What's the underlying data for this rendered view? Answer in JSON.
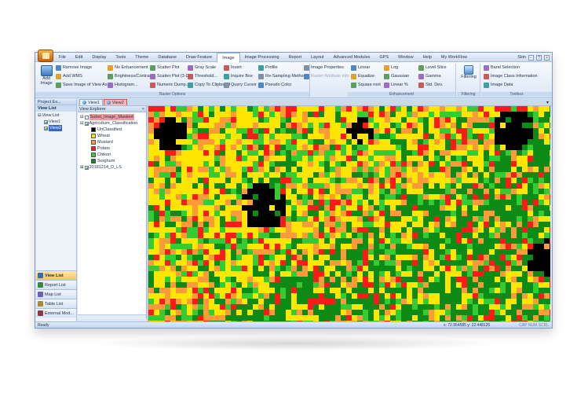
{
  "menu": {
    "items": [
      "File",
      "Edit",
      "Display",
      "Tools",
      "Theme",
      "Database",
      "Draw Feature",
      "Image",
      "Image Processing",
      "Report",
      "Layout",
      "Advanced Modules",
      "GPS",
      "Window",
      "Help",
      "My WorkFlow"
    ],
    "active": "Image",
    "skin_label": "Skin",
    "help_glyph": "?"
  },
  "ribbon": {
    "add_image": {
      "line1": "Add",
      "line2": "Image"
    },
    "col1": [
      "Remove Image",
      "Add WMS",
      "Save Image of View As..."
    ],
    "col2": [
      "No Enhancement",
      "Brightness/Contrast...",
      "Histogram..."
    ],
    "col3": [
      "Scatter Plot",
      "Scatter Plot (3-D)",
      "Numeric Dump..."
    ],
    "col4": [
      "Gray Scale",
      "Threshold...",
      "Copy To Clipboard"
    ],
    "col5": [
      "Invert",
      "Inquire Box",
      "Query Cursor"
    ],
    "col6": [
      "Profile",
      "Re-Sampling Method",
      "Pseudo Color"
    ],
    "col7": [
      "Image Properties",
      "Raster Attribute Info",
      ""
    ],
    "group_raster_options": "Raster Options",
    "enh_col1": [
      "Linear",
      "Equalize",
      "Square root"
    ],
    "enh_col2": [
      "Log",
      "Gaussian",
      "Linear %"
    ],
    "enh_col3": [
      "Level Slice",
      "Gamma",
      "Std. Dev."
    ],
    "group_enhancement": "Enhancement",
    "filtering_label": "Filtering",
    "group_filtering": "Filtering",
    "toolbox_items": [
      "Band Selection",
      "Image Class Information",
      "Image Data"
    ],
    "group_toolbox": "Toolbox"
  },
  "project_explorer": {
    "title": "Project Ex...",
    "view_list_header": "View List",
    "tree_root": "View List",
    "views": [
      "View1",
      "View2"
    ],
    "selected_view": "View2",
    "nav_buttons": [
      "View List",
      "Report List",
      "Map List",
      "Table List",
      "External Mod..."
    ]
  },
  "doc_tabs": [
    "View1",
    "View2"
  ],
  "active_doc_tab": "View2",
  "view_explorer": {
    "title": "View Explorer",
    "layer1": "Subet_Image_Masked",
    "layer2": "Agriculture_Classification",
    "classes": [
      {
        "name": "UnClassified",
        "color": "#000000"
      },
      {
        "name": "Wheat",
        "color": "#ffe600"
      },
      {
        "name": "Mustard",
        "color": "#ff9a3a"
      },
      {
        "name": "Potato",
        "color": "#ff1a1a"
      },
      {
        "name": "Chikori",
        "color": "#33cc33"
      },
      {
        "name": "Sorghum",
        "color": "#0e8a16"
      }
    ],
    "layer3": "20181214_D_LS"
  },
  "status": {
    "left": "Ready",
    "coords": "x: 72.954585   y: 22.448126",
    "keys": "CAP  NUM  SCRL"
  },
  "colors": {
    "accent": "#3366cc",
    "ribbon_bg": "#dce7f5",
    "active_nav": "#f7c35a"
  }
}
